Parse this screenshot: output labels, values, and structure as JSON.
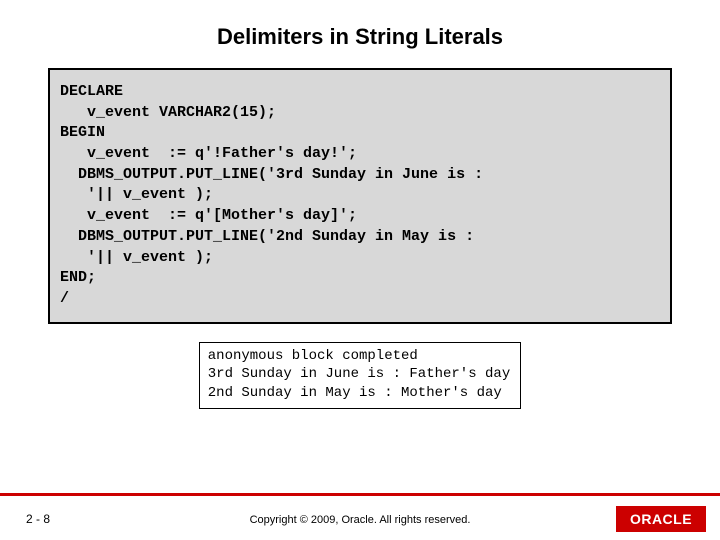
{
  "title": "Delimiters in String Literals",
  "code": "DECLARE\n   v_event VARCHAR2(15);\nBEGIN\n   v_event  := q'!Father's day!';\n  DBMS_OUTPUT.PUT_LINE('3rd Sunday in June is :\n   '|| v_event );\n   v_event  := q'[Mother's day]';\n  DBMS_OUTPUT.PUT_LINE('2nd Sunday in May is :\n   '|| v_event );\nEND;\n/",
  "output": "anonymous block completed\n3rd Sunday in June is : Father's day\n2nd Sunday in May is : Mother's day",
  "footer": {
    "page": "2 - 8",
    "copyright": "Copyright © 2009, Oracle. All rights reserved.",
    "logo": "ORACLE"
  }
}
